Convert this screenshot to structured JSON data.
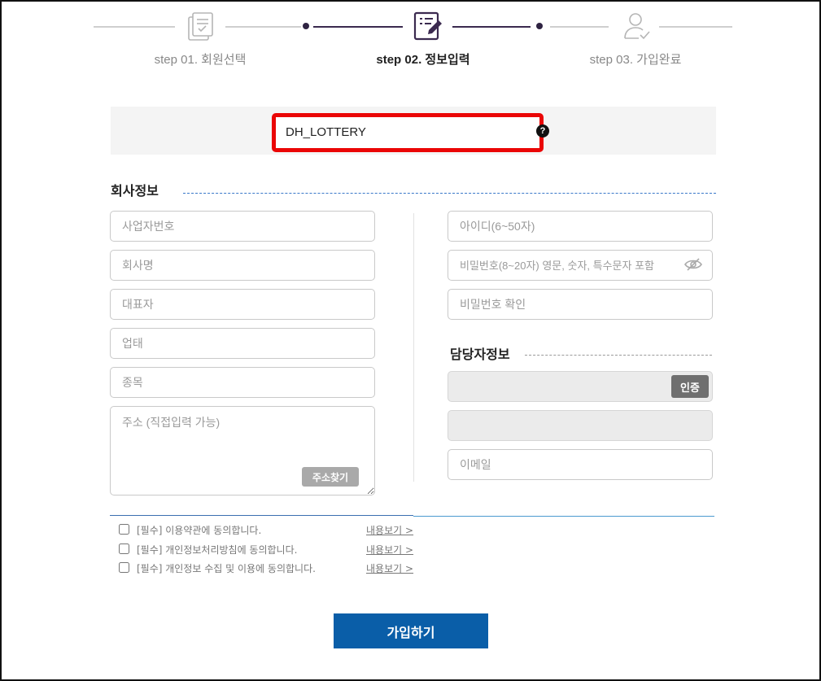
{
  "steps": [
    {
      "icon": "document-check-icon",
      "label": "step 01. 회원선택",
      "active": false
    },
    {
      "icon": "edit-document-icon",
      "label": "step 02. 정보입력",
      "active": true
    },
    {
      "icon": "user-check-icon",
      "label": "step 03. 가입완료",
      "active": false
    }
  ],
  "id_field": {
    "value": "DH_LOTTERY",
    "help_icon": "question-icon",
    "help_glyph": "?",
    "highlight_color": "#ea0606"
  },
  "company": {
    "title": "회사정보",
    "business_number_placeholder": "사업자번호",
    "company_name_placeholder": "회사명",
    "representative_placeholder": "대표자",
    "business_type_placeholder": "업태",
    "business_item_placeholder": "종목",
    "address_placeholder": "주소 (직접입력 가능)",
    "address_search_label": "주소찾기"
  },
  "account": {
    "userid_placeholder": "아이디(6~50자)",
    "password_placeholder": "비밀번호(8~20자) 영문, 숫자, 특수문자 포함",
    "password_confirm_placeholder": "비밀번호 확인",
    "eye_icon": "eye-off-icon"
  },
  "manager": {
    "title": "담당자정보",
    "verify_label": "인증",
    "email_placeholder": "이메일"
  },
  "agreements": [
    {
      "text": "[필수] 이용약관에 동의합니다.",
      "link": "내용보기 >"
    },
    {
      "text": "[필수] 개인정보처리방침에 동의합니다.",
      "link": "내용보기 >"
    },
    {
      "text": "[필수] 개인정보 수집 및 이용에 동의합니다.",
      "link": "내용보기 >"
    }
  ],
  "submit_label": "가입하기",
  "colors": {
    "accent": "#0a5ea8",
    "step_active": "#3b2a4f",
    "highlight": "#ea0606"
  }
}
